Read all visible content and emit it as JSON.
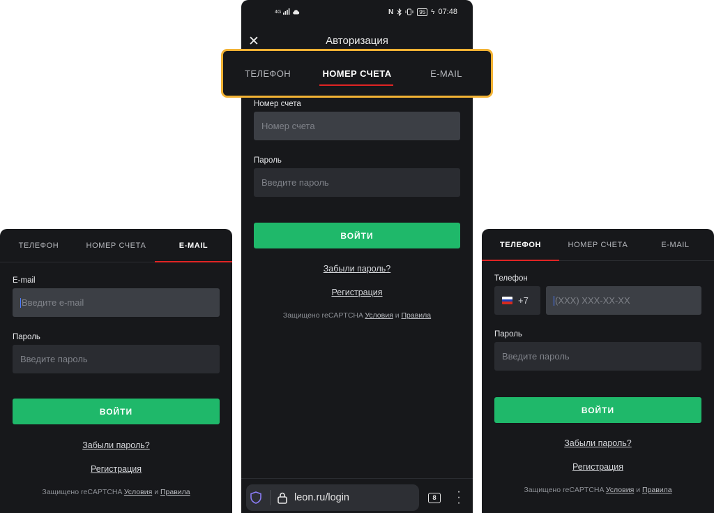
{
  "tabs": {
    "phone": "ТЕЛЕФОН",
    "account": "НОМЕР СЧЕТА",
    "email": "E-MAIL"
  },
  "left_screen": {
    "email_label": "E-mail",
    "email_placeholder": "Введите e-mail",
    "password_label": "Пароль",
    "password_placeholder": "Введите пароль",
    "login_button": "ВОЙТИ",
    "forgot_password": "Забыли пароль?",
    "register": "Регистрация",
    "captcha_prefix": "Защищено reCAPTCHA",
    "captcha_terms": "Условия",
    "captcha_and": "и",
    "captcha_rules": "Правила"
  },
  "center_screen": {
    "status_bar": {
      "network": "4G",
      "battery": "95",
      "time": "07:48"
    },
    "title": "Авторизация",
    "account_label": "Номер счета",
    "account_placeholder": "Номер счета",
    "password_label": "Пароль",
    "password_placeholder": "Введите пароль",
    "login_button": "ВОЙТИ",
    "forgot_password": "Забыли пароль?",
    "register": "Регистрация",
    "captcha_prefix": "Защищено reCAPTCHA",
    "captcha_terms": "Условия",
    "captcha_and": "и",
    "captcha_rules": "Правила",
    "browser": {
      "url": "leon.ru/login",
      "tab_count": "8"
    }
  },
  "right_screen": {
    "phone_label": "Телефон",
    "country_code": "+7",
    "phone_placeholder": "(XXX) XXX-XX-XX",
    "password_label": "Пароль",
    "password_placeholder": "Введите пароль",
    "login_button": "ВОЙТИ",
    "forgot_password": "Забыли пароль?",
    "register": "Регистрация",
    "captcha_prefix": "Защищено reCAPTCHA",
    "captcha_terms": "Условия",
    "captcha_and": "и",
    "captcha_rules": "Правила"
  },
  "colors": {
    "background": "#17181b",
    "input": "#3c3f45",
    "accent_green": "#1fb86a",
    "tab_underline": "#e02424",
    "highlight_border": "#f2b234"
  }
}
